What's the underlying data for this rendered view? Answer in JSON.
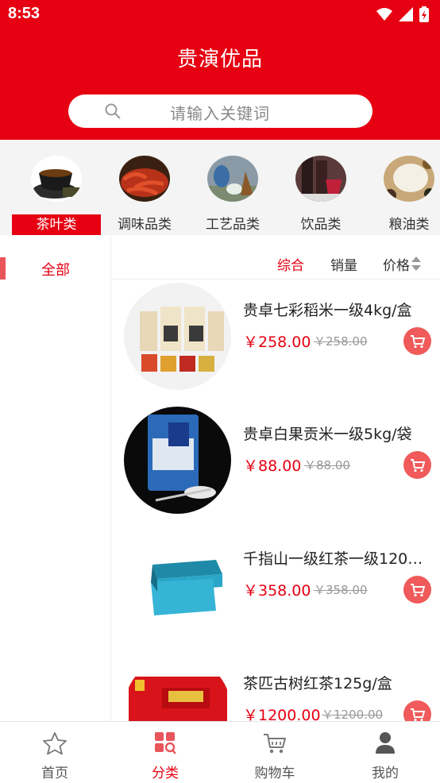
{
  "status_bar": {
    "time": "8:53"
  },
  "header": {
    "title": "贵演优品"
  },
  "search": {
    "placeholder": "请输入关键词"
  },
  "categories": [
    {
      "label": "茶叶类",
      "active": true
    },
    {
      "label": "调味品类",
      "active": false
    },
    {
      "label": "工艺品类",
      "active": false
    },
    {
      "label": "饮品类",
      "active": false
    },
    {
      "label": "粮油类",
      "active": false
    }
  ],
  "sidebar": {
    "items": [
      {
        "label": "全部",
        "active": true
      }
    ]
  },
  "sort": {
    "comprehensive": "综合",
    "sales": "销量",
    "price": "价格"
  },
  "products": [
    {
      "name": "贵卓七彩稻米一级4kg/盒",
      "price": "￥258.00",
      "old_price": "￥258.00"
    },
    {
      "name": "贵卓白果贡米一级5kg/袋",
      "price": "￥88.00",
      "old_price": "￥88.00"
    },
    {
      "name": "千指山一级红茶一级120…",
      "price": "￥358.00",
      "old_price": "￥358.00"
    },
    {
      "name": "茶匹古树红茶125g/盒",
      "price": "￥1200.00",
      "old_price": "￥1200.00"
    }
  ],
  "tabbar": [
    {
      "label": "首页",
      "icon": "star-icon",
      "active": false
    },
    {
      "label": "分类",
      "icon": "category-grid-icon",
      "active": true
    },
    {
      "label": "购物车",
      "icon": "cart-icon",
      "active": false
    },
    {
      "label": "我的",
      "icon": "person-icon",
      "active": false
    }
  ],
  "colors": {
    "brand": "#e60012",
    "cart_button": "#f05a5a"
  }
}
